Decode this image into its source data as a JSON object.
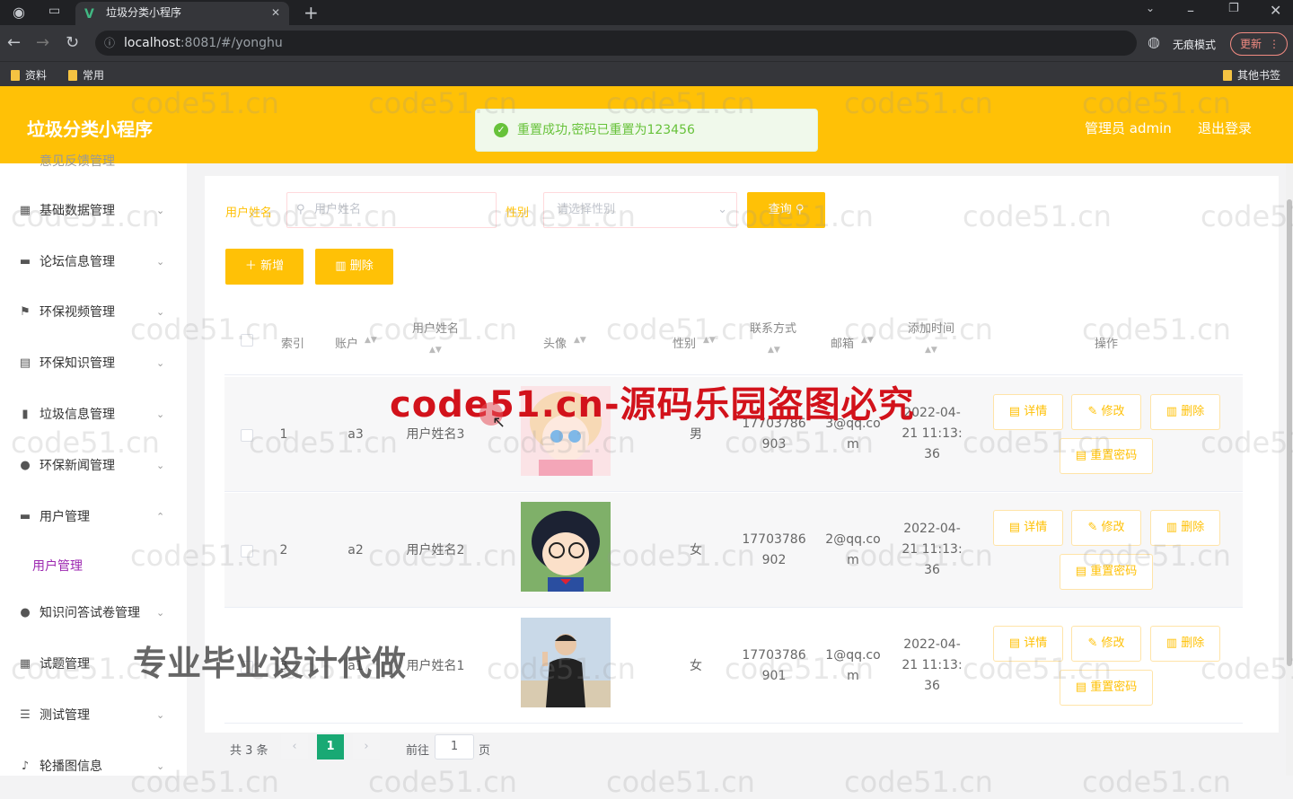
{
  "browser": {
    "tab_title": "垃圾分类小程序",
    "url_host": "localhost",
    "url_rest": ":8081/#/yonghu",
    "incognito": "无痕模式",
    "update": "更新",
    "bookmarks": [
      "资料",
      "常用"
    ],
    "other_bookmarks": "其他书签"
  },
  "header": {
    "brand": "垃圾分类小程序",
    "user": "管理员 admin",
    "logout": "退出登录",
    "toast": "重置成功,密码已重置为123456"
  },
  "sidebar": {
    "cut_item": "意见反馈管理",
    "items": [
      {
        "label": "基础数据管理",
        "icon": "grid-icon"
      },
      {
        "label": "论坛信息管理",
        "icon": "monitor-icon"
      },
      {
        "label": "环保视频管理",
        "icon": "flag-icon"
      },
      {
        "label": "环保知识管理",
        "icon": "clipboard-icon"
      },
      {
        "label": "垃圾信息管理",
        "icon": "bar-chart-icon"
      },
      {
        "label": "环保新闻管理",
        "icon": "bulb-icon"
      },
      {
        "label": "用户管理",
        "icon": "chat-icon"
      },
      {
        "label": "知识问答试卷管理",
        "icon": "person-icon"
      },
      {
        "label": "试题管理",
        "icon": "keyboard-icon"
      },
      {
        "label": "测试管理",
        "icon": "list-icon"
      },
      {
        "label": "轮播图信息",
        "icon": "mic-icon"
      }
    ],
    "active_sub": "用户管理"
  },
  "search": {
    "name_label": "用户姓名",
    "name_placeholder": "用户姓名",
    "gender_label": "性别",
    "gender_placeholder": "请选择性别",
    "query": "查询"
  },
  "actions": {
    "add": "新增",
    "delete": "删除"
  },
  "table": {
    "headers": {
      "index": "索引",
      "account": "账户",
      "name": "用户姓名",
      "avatar": "头像",
      "gender": "性别",
      "phone": "联系方式",
      "email": "邮箱",
      "time": "添加时间",
      "ops": "操作"
    },
    "rows": [
      {
        "index": "1",
        "account": "a3",
        "name": "用户姓名3",
        "gender": "男",
        "phone1": "17703786",
        "phone2": "903",
        "email1": "3@qq.co",
        "email2": "m",
        "t1": "2022-04-",
        "t2": "21 11:13:",
        "t3": "36"
      },
      {
        "index": "2",
        "account": "a2",
        "name": "用户姓名2",
        "gender": "女",
        "phone1": "17703786",
        "phone2": "902",
        "email1": "2@qq.co",
        "email2": "m",
        "t1": "2022-04-",
        "t2": "21 11:13:",
        "t3": "36"
      },
      {
        "index": "3",
        "account": "a1",
        "name": "用户姓名1",
        "gender": "女",
        "phone1": "17703786",
        "phone2": "901",
        "email1": "1@qq.co",
        "email2": "m",
        "t1": "2022-04-",
        "t2": "21 11:13:",
        "t3": "36"
      }
    ],
    "op_labels": {
      "detail": "详情",
      "edit": "修改",
      "delete": "删除",
      "reset": "重置密码"
    }
  },
  "pagination": {
    "total": "共 3 条",
    "current": "1",
    "goto": "前往",
    "page_input": "1",
    "page_suffix": "页"
  },
  "watermarks": {
    "site": "code51.cn",
    "red": "code51.cn-源码乐园盗图必究",
    "gray": "专业毕业设计代做"
  }
}
